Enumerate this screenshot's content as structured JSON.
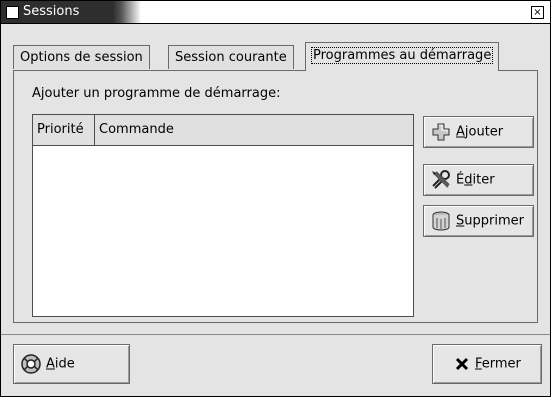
{
  "window": {
    "title": "Sessions",
    "close_symbol": "×"
  },
  "tabs": [
    {
      "label": "Options de session",
      "active": false
    },
    {
      "label": "Session courante",
      "active": false
    },
    {
      "label": "Programmes au démarrage",
      "active": true
    }
  ],
  "panel": {
    "label": "Ajouter un programme de démarrage:",
    "columns": [
      "Priorité",
      "Commande"
    ],
    "rows": []
  },
  "buttons": {
    "add": {
      "mn": "A",
      "rest": "jouter",
      "icon": "plus-icon"
    },
    "edit": {
      "pre": "É",
      "mn": "d",
      "rest": "iter",
      "icon": "tools-icon"
    },
    "remove": {
      "mn": "S",
      "rest": "upprimer",
      "icon": "trash-icon"
    },
    "help": {
      "mn": "A",
      "rest": "ide",
      "icon": "lifebuoy-icon"
    },
    "close": {
      "mn": "F",
      "rest": "ermer",
      "icon": "x-icon"
    }
  }
}
